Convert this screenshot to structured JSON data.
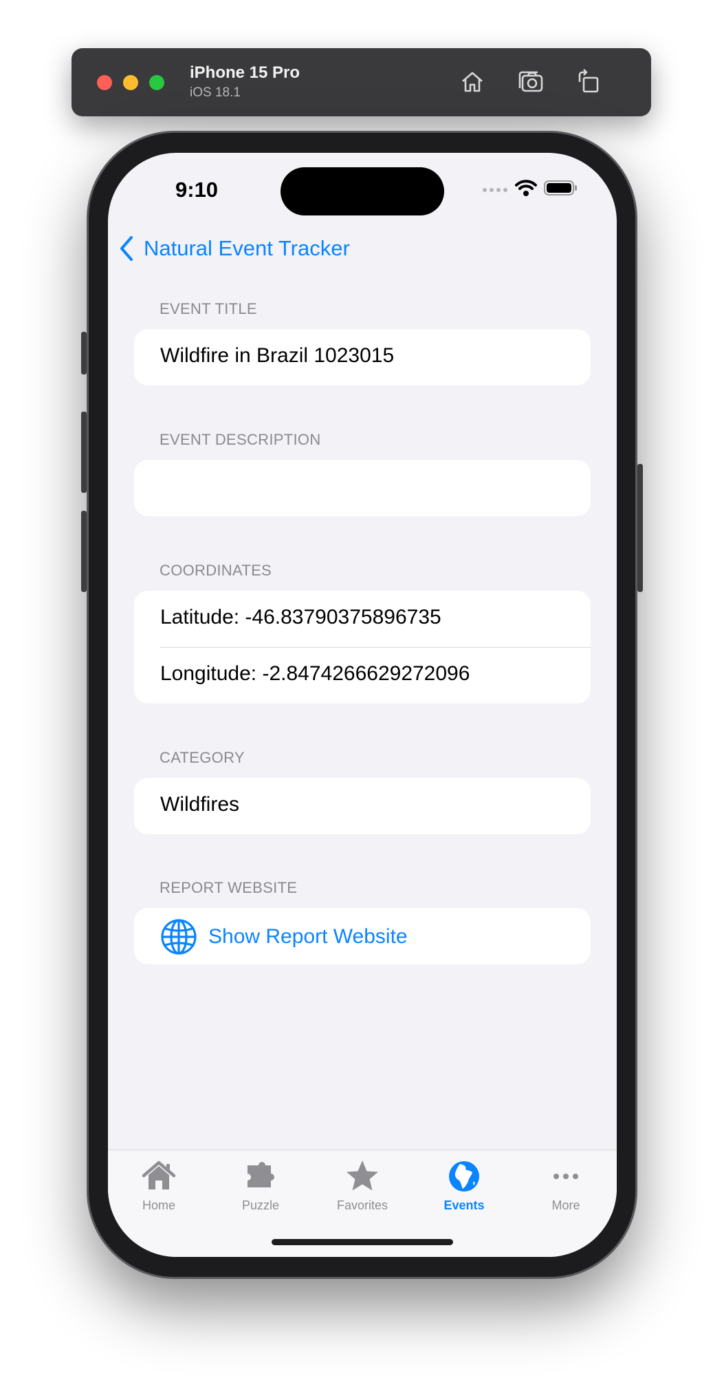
{
  "simulator": {
    "device_name": "iPhone 15 Pro",
    "os_version": "iOS 18.1",
    "buttons": [
      "home-icon",
      "screenshot-icon",
      "rotate-icon"
    ]
  },
  "status_bar": {
    "time": "9:10"
  },
  "nav": {
    "back_label": "Natural Event Tracker"
  },
  "sections": {
    "title": {
      "header": "EVENT TITLE",
      "value": "Wildfire in Brazil 1023015"
    },
    "description": {
      "header": "EVENT DESCRIPTION",
      "value": ""
    },
    "coordinates": {
      "header": "COORDINATES",
      "latitude": "Latitude: -46.83790375896735",
      "longitude": "Longitude: -2.8474266629272096"
    },
    "category": {
      "header": "CATEGORY",
      "value": "Wildfires"
    },
    "website": {
      "header": "REPORT WEBSITE",
      "link_label": "Show Report Website",
      "icon": "globe-icon"
    }
  },
  "tabbar": {
    "tabs": [
      {
        "label": "Home",
        "icon": "house-icon",
        "active": false
      },
      {
        "label": "Puzzle",
        "icon": "puzzle-icon",
        "active": false
      },
      {
        "label": "Favorites",
        "icon": "star-icon",
        "active": false
      },
      {
        "label": "Events",
        "icon": "globe-africa-icon",
        "active": true
      },
      {
        "label": "More",
        "icon": "ellipsis-icon",
        "active": false
      }
    ]
  },
  "colors": {
    "accent": "#0a84ff",
    "background": "#f2f2f7",
    "inactive": "#8e8e93"
  }
}
